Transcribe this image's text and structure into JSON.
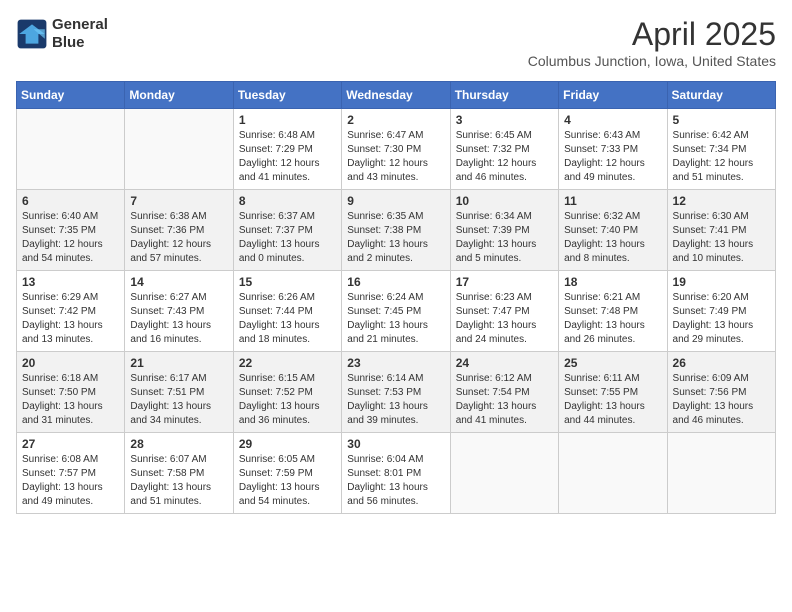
{
  "header": {
    "logo_line1": "General",
    "logo_line2": "Blue",
    "month": "April 2025",
    "location": "Columbus Junction, Iowa, United States"
  },
  "weekdays": [
    "Sunday",
    "Monday",
    "Tuesday",
    "Wednesday",
    "Thursday",
    "Friday",
    "Saturday"
  ],
  "weeks": [
    [
      {
        "day": "",
        "info": ""
      },
      {
        "day": "",
        "info": ""
      },
      {
        "day": "1",
        "info": "Sunrise: 6:48 AM\nSunset: 7:29 PM\nDaylight: 12 hours and 41 minutes."
      },
      {
        "day": "2",
        "info": "Sunrise: 6:47 AM\nSunset: 7:30 PM\nDaylight: 12 hours and 43 minutes."
      },
      {
        "day": "3",
        "info": "Sunrise: 6:45 AM\nSunset: 7:32 PM\nDaylight: 12 hours and 46 minutes."
      },
      {
        "day": "4",
        "info": "Sunrise: 6:43 AM\nSunset: 7:33 PM\nDaylight: 12 hours and 49 minutes."
      },
      {
        "day": "5",
        "info": "Sunrise: 6:42 AM\nSunset: 7:34 PM\nDaylight: 12 hours and 51 minutes."
      }
    ],
    [
      {
        "day": "6",
        "info": "Sunrise: 6:40 AM\nSunset: 7:35 PM\nDaylight: 12 hours and 54 minutes."
      },
      {
        "day": "7",
        "info": "Sunrise: 6:38 AM\nSunset: 7:36 PM\nDaylight: 12 hours and 57 minutes."
      },
      {
        "day": "8",
        "info": "Sunrise: 6:37 AM\nSunset: 7:37 PM\nDaylight: 13 hours and 0 minutes."
      },
      {
        "day": "9",
        "info": "Sunrise: 6:35 AM\nSunset: 7:38 PM\nDaylight: 13 hours and 2 minutes."
      },
      {
        "day": "10",
        "info": "Sunrise: 6:34 AM\nSunset: 7:39 PM\nDaylight: 13 hours and 5 minutes."
      },
      {
        "day": "11",
        "info": "Sunrise: 6:32 AM\nSunset: 7:40 PM\nDaylight: 13 hours and 8 minutes."
      },
      {
        "day": "12",
        "info": "Sunrise: 6:30 AM\nSunset: 7:41 PM\nDaylight: 13 hours and 10 minutes."
      }
    ],
    [
      {
        "day": "13",
        "info": "Sunrise: 6:29 AM\nSunset: 7:42 PM\nDaylight: 13 hours and 13 minutes."
      },
      {
        "day": "14",
        "info": "Sunrise: 6:27 AM\nSunset: 7:43 PM\nDaylight: 13 hours and 16 minutes."
      },
      {
        "day": "15",
        "info": "Sunrise: 6:26 AM\nSunset: 7:44 PM\nDaylight: 13 hours and 18 minutes."
      },
      {
        "day": "16",
        "info": "Sunrise: 6:24 AM\nSunset: 7:45 PM\nDaylight: 13 hours and 21 minutes."
      },
      {
        "day": "17",
        "info": "Sunrise: 6:23 AM\nSunset: 7:47 PM\nDaylight: 13 hours and 24 minutes."
      },
      {
        "day": "18",
        "info": "Sunrise: 6:21 AM\nSunset: 7:48 PM\nDaylight: 13 hours and 26 minutes."
      },
      {
        "day": "19",
        "info": "Sunrise: 6:20 AM\nSunset: 7:49 PM\nDaylight: 13 hours and 29 minutes."
      }
    ],
    [
      {
        "day": "20",
        "info": "Sunrise: 6:18 AM\nSunset: 7:50 PM\nDaylight: 13 hours and 31 minutes."
      },
      {
        "day": "21",
        "info": "Sunrise: 6:17 AM\nSunset: 7:51 PM\nDaylight: 13 hours and 34 minutes."
      },
      {
        "day": "22",
        "info": "Sunrise: 6:15 AM\nSunset: 7:52 PM\nDaylight: 13 hours and 36 minutes."
      },
      {
        "day": "23",
        "info": "Sunrise: 6:14 AM\nSunset: 7:53 PM\nDaylight: 13 hours and 39 minutes."
      },
      {
        "day": "24",
        "info": "Sunrise: 6:12 AM\nSunset: 7:54 PM\nDaylight: 13 hours and 41 minutes."
      },
      {
        "day": "25",
        "info": "Sunrise: 6:11 AM\nSunset: 7:55 PM\nDaylight: 13 hours and 44 minutes."
      },
      {
        "day": "26",
        "info": "Sunrise: 6:09 AM\nSunset: 7:56 PM\nDaylight: 13 hours and 46 minutes."
      }
    ],
    [
      {
        "day": "27",
        "info": "Sunrise: 6:08 AM\nSunset: 7:57 PM\nDaylight: 13 hours and 49 minutes."
      },
      {
        "day": "28",
        "info": "Sunrise: 6:07 AM\nSunset: 7:58 PM\nDaylight: 13 hours and 51 minutes."
      },
      {
        "day": "29",
        "info": "Sunrise: 6:05 AM\nSunset: 7:59 PM\nDaylight: 13 hours and 54 minutes."
      },
      {
        "day": "30",
        "info": "Sunrise: 6:04 AM\nSunset: 8:01 PM\nDaylight: 13 hours and 56 minutes."
      },
      {
        "day": "",
        "info": ""
      },
      {
        "day": "",
        "info": ""
      },
      {
        "day": "",
        "info": ""
      }
    ]
  ]
}
